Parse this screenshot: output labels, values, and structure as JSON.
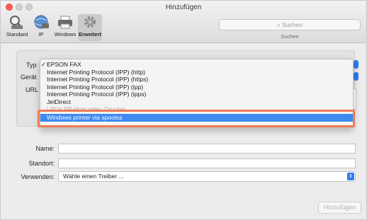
{
  "window": {
    "title": "Hinzufügen"
  },
  "toolbar": {
    "buttons": [
      {
        "label": "Standard",
        "icon": "magnifier-printer-icon"
      },
      {
        "label": "IP",
        "icon": "globe-icon"
      },
      {
        "label": "Windows",
        "icon": "windows-printer-icon"
      },
      {
        "label": "Erweitert",
        "icon": "gear-icon",
        "active": true
      }
    ],
    "search": {
      "placeholder": "Suchen",
      "caption": "Suchen"
    }
  },
  "form_upper": {
    "type_label": "Typ",
    "device_label": "Gerät",
    "url_label": "URL"
  },
  "type_menu": {
    "items": [
      {
        "label": "EPSON FAX",
        "checked": true
      },
      {
        "label": "Internet Printing Protocol (IPP) (http)"
      },
      {
        "label": "Internet Printing Protocol (IPP) (https)"
      },
      {
        "label": "Internet Printing Protocol (IPP) (ipp)"
      },
      {
        "label": "Internet Printing Protocol (IPP) (ipps)"
      },
      {
        "label": "JetDirect"
      },
      {
        "label": "LPD/LPR-Host oder -Drucker",
        "faded": true
      },
      {
        "label": "Windows printer via spoolss",
        "selected": true
      }
    ],
    "check_mark": "✓"
  },
  "form_lower": {
    "name_label": "Name:",
    "location_label": "Standort:",
    "use_label": "Verwenden:",
    "use_value": "Wähle einen Treiber ...",
    "use_arrows": "⇕"
  },
  "footer": {
    "add_button": "Hinzufügen"
  },
  "colors": {
    "accent": "#3d8af0",
    "highlight_frame": "#ef7a56",
    "close": "#fc5f57"
  }
}
